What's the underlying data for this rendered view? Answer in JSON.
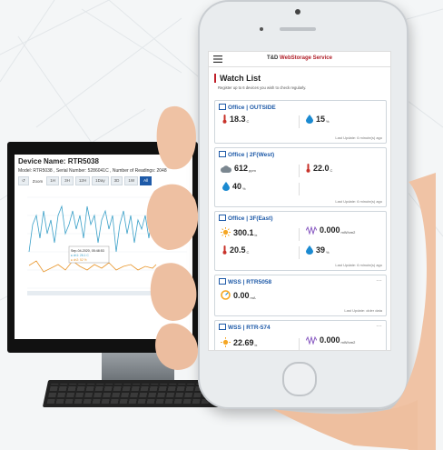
{
  "monitor": {
    "device_title": "Device Name: RTR5038",
    "device_sub": "Model: RTR5038 , Serial Number: 5286041C , Number of Readings: 2048",
    "zoom_label": "Zoom",
    "zoom_buttons": [
      "1H",
      "3H",
      "12H",
      "1Day",
      "3D",
      "1W",
      "All"
    ],
    "tooltip_line1": "Sep-04-2020, 05:48:53",
    "tooltip_line2": "● ch1: 26.1 C",
    "tooltip_line3": "● ch2: 52 %"
  },
  "app": {
    "title_prefix": "T&D",
    "title_brand": "WebStorage Service",
    "watch_heading": "Watch List",
    "watch_sub": "Register up to 6 devices you wish to check regularly.",
    "cards": [
      {
        "header": "Office | OUTSIDE",
        "readings": [
          {
            "icon": "thermometer-icon",
            "value": "18.3",
            "unit": "C"
          },
          {
            "icon": "water-drop-icon",
            "value": "15",
            "unit": "%"
          }
        ],
        "updated": "Last Update: 6 minute(s) ago"
      },
      {
        "header": "Office | 2F(West)",
        "readings": [
          {
            "icon": "co2-cloud-icon",
            "value": "612",
            "unit": "ppm"
          },
          {
            "icon": "thermometer-icon",
            "value": "22.0",
            "unit": "C"
          },
          {
            "icon": "water-drop-icon",
            "value": "40",
            "unit": "%"
          }
        ],
        "updated": "Last Update: 6 minute(s) ago"
      },
      {
        "header": "Office | 3F(East)",
        "readings": [
          {
            "icon": "sun-icon",
            "value": "300.1",
            "unit": "lx"
          },
          {
            "icon": "uv-icon",
            "value": "0.000",
            "unit": "mW/cm2"
          },
          {
            "icon": "thermometer-icon",
            "value": "20.5",
            "unit": "C"
          },
          {
            "icon": "water-drop-icon",
            "value": "39",
            "unit": "%"
          }
        ],
        "updated": "Last Update: 6 minute(s) ago"
      },
      {
        "header": "WSS | RTR5058",
        "readings": [
          {
            "icon": "gauge-icon",
            "value": "0.00",
            "unit": "mA"
          }
        ],
        "updated": "Last Update: older data"
      },
      {
        "header": "WSS | RTR-574",
        "readings": [
          {
            "icon": "sun-icon",
            "value": "22.69",
            "unit": "lx"
          },
          {
            "icon": "uv-icon",
            "value": "0.000",
            "unit": "mW/cm2"
          }
        ],
        "updated": ""
      }
    ],
    "more_dots": "…"
  },
  "colors": {
    "accent_red": "#b0202a",
    "link_blue": "#1e5aa8",
    "temp_red": "#c8322a",
    "humidity_blue": "#1b8ad1",
    "sun_orange": "#f5a623"
  }
}
